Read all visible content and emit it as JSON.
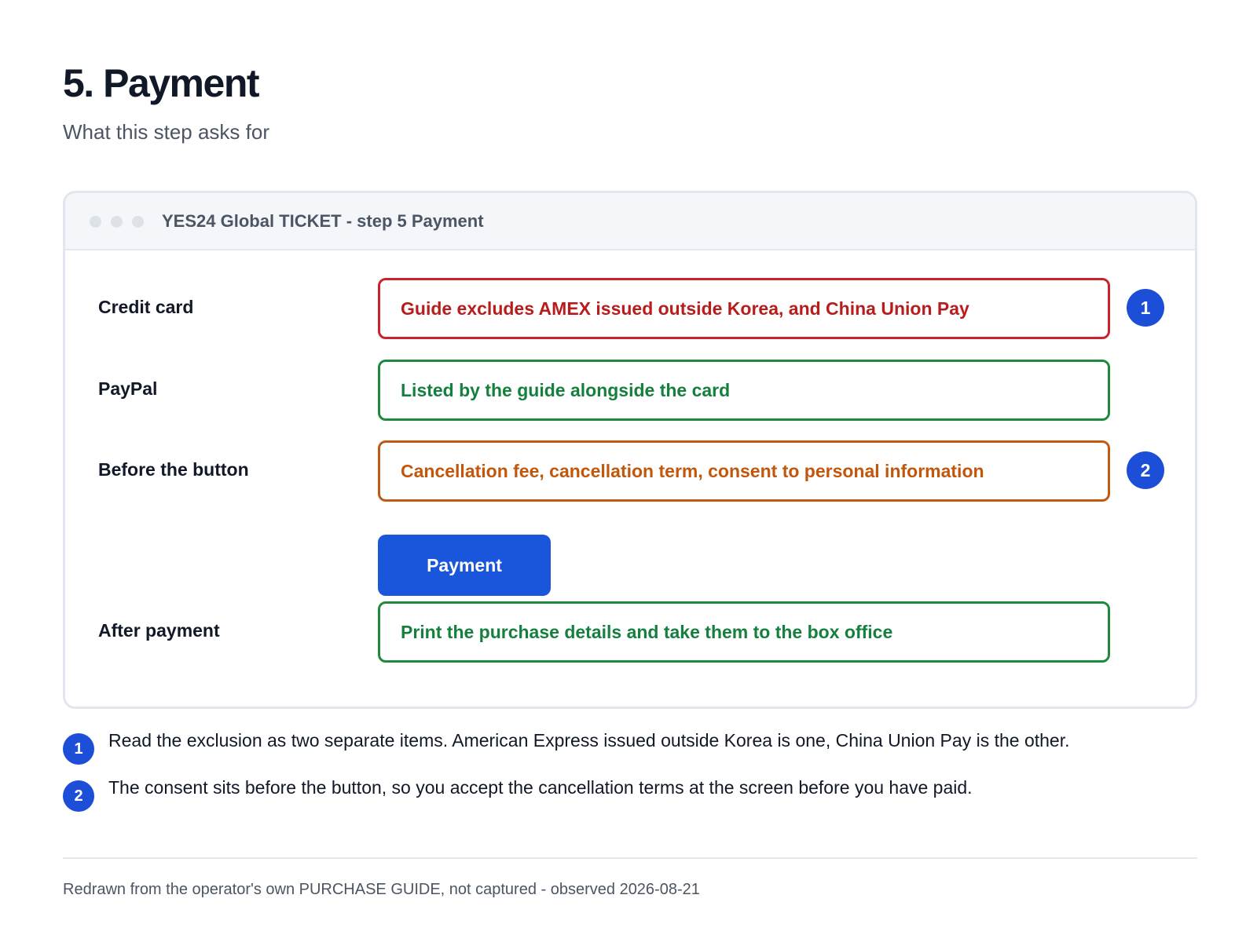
{
  "header": {
    "title": "5. Payment",
    "subtitle": "What this step asks for"
  },
  "window": {
    "title": "YES24 Global TICKET - step 5 Payment",
    "rows": [
      {
        "label": "Credit card",
        "value": "Guide excludes AMEX issued outside Korea, and China Union Pay",
        "status": "red",
        "marker": "1"
      },
      {
        "label": "PayPal",
        "value": "Listed by the guide alongside the card",
        "status": "green"
      },
      {
        "label": "Before the button",
        "value": "Cancellation fee, cancellation term, consent to personal information",
        "status": "orange",
        "marker": "2"
      },
      {
        "label": "After payment",
        "value": "Print the purchase details and take them to the box office",
        "status": "green"
      }
    ],
    "payment_button_label": "Payment"
  },
  "notes": [
    {
      "marker": "1",
      "text": "Read the exclusion as two separate items. American Express issued outside Korea is one, China Union Pay is the other."
    },
    {
      "marker": "2",
      "text": "The consent sits before the button, so you accept the cancellation terms at the screen before you have paid."
    }
  ],
  "footer": {
    "text": "Redrawn from the operator's own PURCHASE GUIDE, not captured - observed 2026-08-21"
  },
  "colors": {
    "accent": "#1a56db",
    "red": "#b91c1c",
    "green": "#15803d",
    "orange": "#c2570c"
  }
}
